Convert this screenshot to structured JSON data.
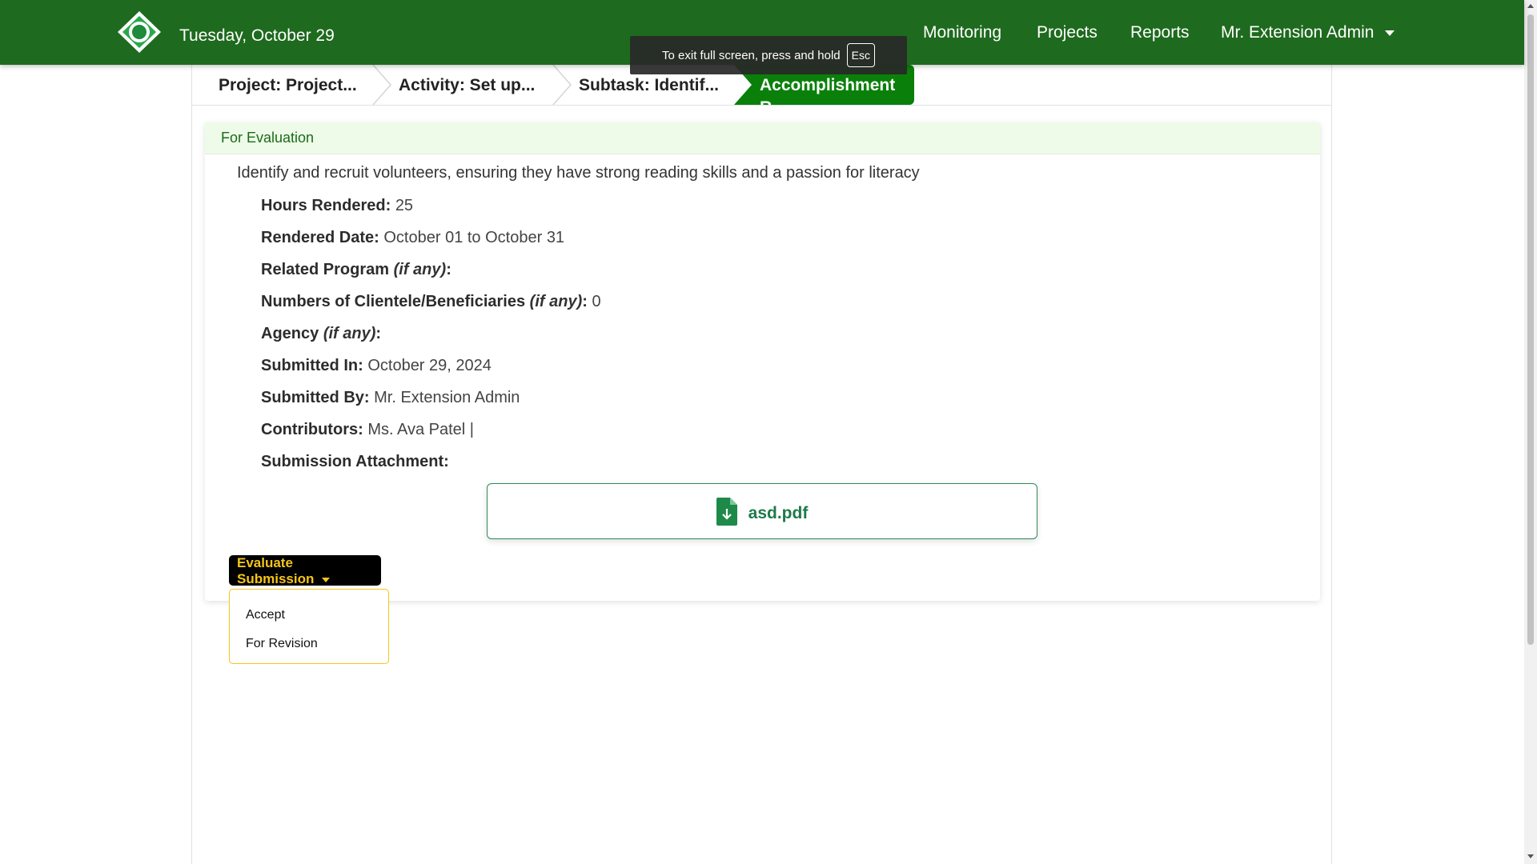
{
  "navbar": {
    "date": "Tuesday, October 29",
    "links": {
      "monitoring": "Monitoring",
      "projects": "Projects",
      "reports": "Reports"
    },
    "user": "Mr. Extension Admin",
    "brand_color": "#1e6a1e"
  },
  "fullscreen_notice": {
    "text": "To exit full screen, press and hold",
    "key": "Esc"
  },
  "breadcrumb": {
    "project": "Project: Project...",
    "activity": "Activity: Set up...",
    "subtask": "Subtask: Identif...",
    "active": "Accomplishment R..."
  },
  "card": {
    "status": "For Evaluation",
    "title": "Identify and recruit volunteers, ensuring they have strong reading skills and a passion for literacy",
    "fields": {
      "hours_label": "Hours Rendered:",
      "hours_value": "25",
      "date_label": "Rendered Date:",
      "date_value": "October 01 to October 31",
      "program_label": "Related Program",
      "program_note": "(if any)",
      "program_value": "",
      "clientele_label": "Numbers of Clientele/Beneficiaries",
      "clientele_note": "(if any)",
      "clientele_value": "0",
      "agency_label": "Agency",
      "agency_note": "(if any)",
      "agency_value": "",
      "submitted_in_label": "Submitted In:",
      "submitted_in_value": "October 29, 2024",
      "submitted_by_label": "Submitted By:",
      "submitted_by_value": "Mr. Extension Admin",
      "contributors_label": "Contributors:",
      "contributors_value": "Ms. Ava Patel |",
      "attachment_label": "Submission Attachment:"
    },
    "attachment": {
      "name": "asd.pdf",
      "icon": "file-download-icon"
    }
  },
  "evaluate": {
    "button": "Evaluate Submission",
    "options": {
      "accept": "Accept",
      "revision": "For Revision"
    }
  },
  "colors": {
    "accent_green": "#0a800a",
    "header_bg": "#eefbe8",
    "button_bg": "#000000",
    "button_text": "#f5c518"
  }
}
